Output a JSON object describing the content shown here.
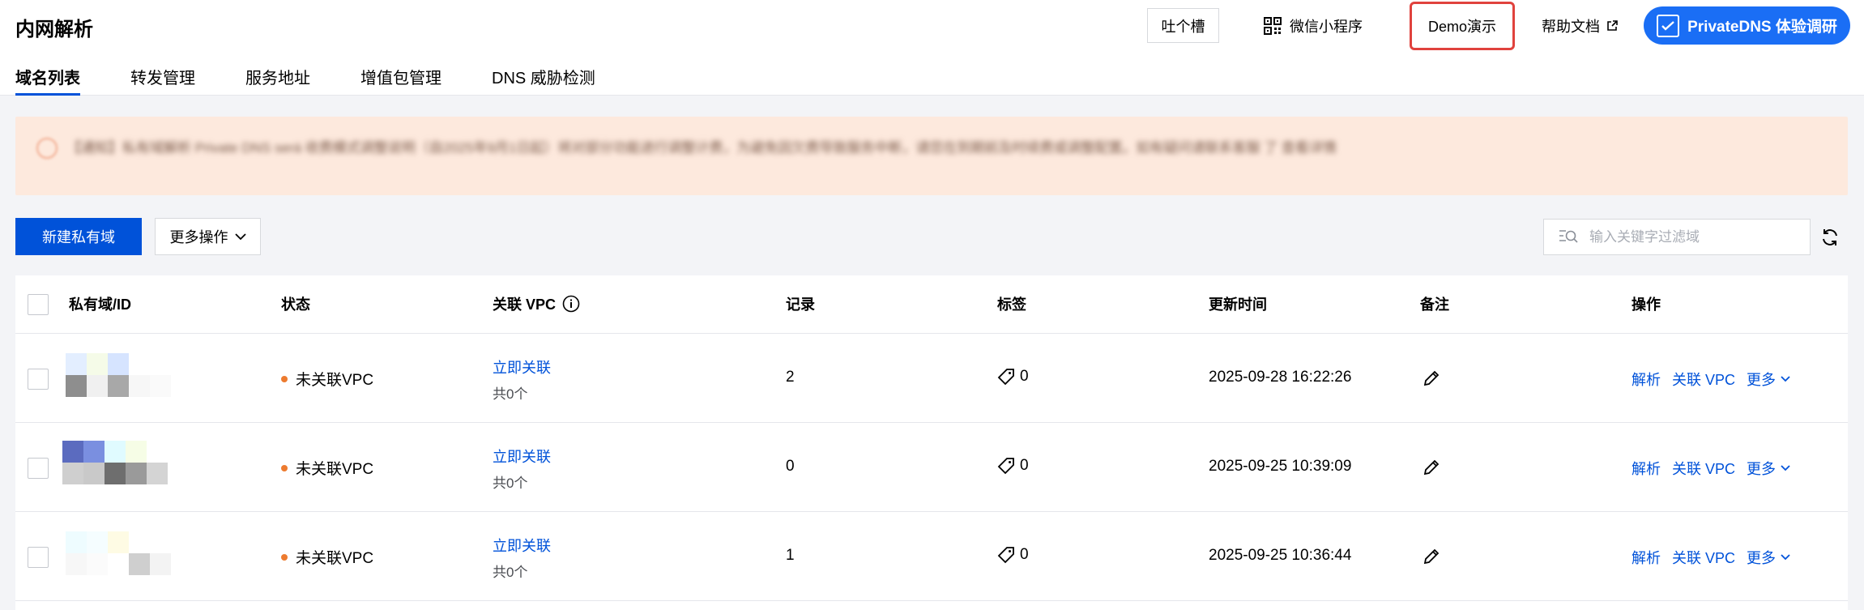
{
  "header": {
    "title": "内网解析",
    "feedback": "吐个槽",
    "wechat": "微信小程序",
    "demo": "Demo演示",
    "help": "帮助文档",
    "survey": "PrivateDNS 体验调研"
  },
  "tabs": [
    "域名列表",
    "转发管理",
    "服务地址",
    "增值包管理",
    "DNS 威胁检测"
  ],
  "notice": {
    "text": "【通知】私有域解析 Private DNS será 收费模式调整说明（自2025年9月1日起）将对部分功能进行调整计费，为避免因欠费导致服务中断，请您在到期前及时续费或调整配置。如有疑问请联系客服 了 查看详情"
  },
  "toolbar": {
    "create": "新建私有域",
    "more": "更多操作",
    "search_placeholder": "输入关键字过滤域"
  },
  "table": {
    "columns": {
      "domain": "私有域/ID",
      "status": "状态",
      "vpc": "关联 VPC",
      "records": "记录",
      "tags": "标签",
      "updated": "更新时间",
      "remark": "备注",
      "ops": "操作"
    },
    "rows": [
      {
        "status": "未关联VPC",
        "vpc_link": "立即关联",
        "vpc_count": "共0个",
        "records": "2",
        "tags": "0",
        "updated": "2025-09-28 16:22:26",
        "ops": [
          "解析",
          "关联 VPC",
          "更多"
        ],
        "mosaic": [
          "#e3eeff",
          "#f5fbe8",
          "#d6e4ff",
          "#ffffff",
          "#ffffff",
          "#8e8e8e",
          "#f0f0f0",
          "#a8a8a8",
          "#f7f7f7",
          "#fafafa"
        ]
      },
      {
        "status": "未关联VPC",
        "vpc_link": "立即关联",
        "vpc_count": "共0个",
        "records": "0",
        "tags": "0",
        "updated": "2025-09-25 10:39:09",
        "ops": [
          "解析",
          "关联 VPC",
          "更多"
        ],
        "mosaic": [
          "#5b6bbf",
          "#7a8fe0",
          "#e0fbff",
          "#f6fde6",
          "#ffffff",
          "#cfcfcf",
          "#c9c9c9",
          "#6e6e6e",
          "#9a9a9a",
          "#d4d4d4"
        ]
      },
      {
        "status": "未关联VPC",
        "vpc_link": "立即关联",
        "vpc_count": "共0个",
        "records": "1",
        "tags": "0",
        "updated": "2025-09-25 10:36:44",
        "ops": [
          "解析",
          "关联 VPC",
          "更多"
        ],
        "mosaic": [
          "#eefcff",
          "#f5fdff",
          "#fefbe4",
          "#ffffff",
          "#ffffff",
          "#f7f7f7",
          "#fbfbfb",
          "#ffffff",
          "#cfcfcf",
          "#f3f3f3"
        ]
      }
    ]
  }
}
